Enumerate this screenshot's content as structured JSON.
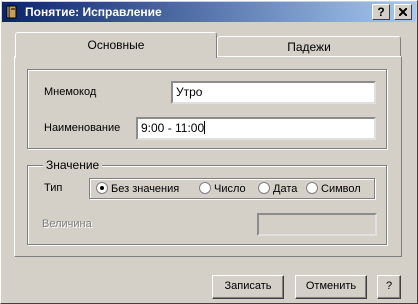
{
  "window": {
    "title": "Понятие: Исправление",
    "help_label": "?",
    "close_label": "X"
  },
  "tabs": [
    {
      "label": "Основные",
      "active": true
    },
    {
      "label": "Падежи",
      "active": false
    }
  ],
  "fields": {
    "mnemocode_label": "Мнемокод",
    "mnemocode_value": "Утро",
    "name_label": "Наименование",
    "name_value": "9:00 - 11:00"
  },
  "value_group": {
    "legend": "Значение",
    "type_label": "Тип",
    "options": [
      {
        "label": "Без значения",
        "selected": true
      },
      {
        "label": "Число",
        "selected": false
      },
      {
        "label": "Дата",
        "selected": false
      },
      {
        "label": "Символ",
        "selected": false
      }
    ],
    "magnitude_label": "Величина",
    "magnitude_value": ""
  },
  "buttons": {
    "save": "Записать",
    "cancel": "Отменить",
    "help": "?"
  },
  "colors": {
    "titlebar_start": "#0a246a",
    "titlebar_end": "#a6caf0",
    "face": "#d4d0c8"
  }
}
